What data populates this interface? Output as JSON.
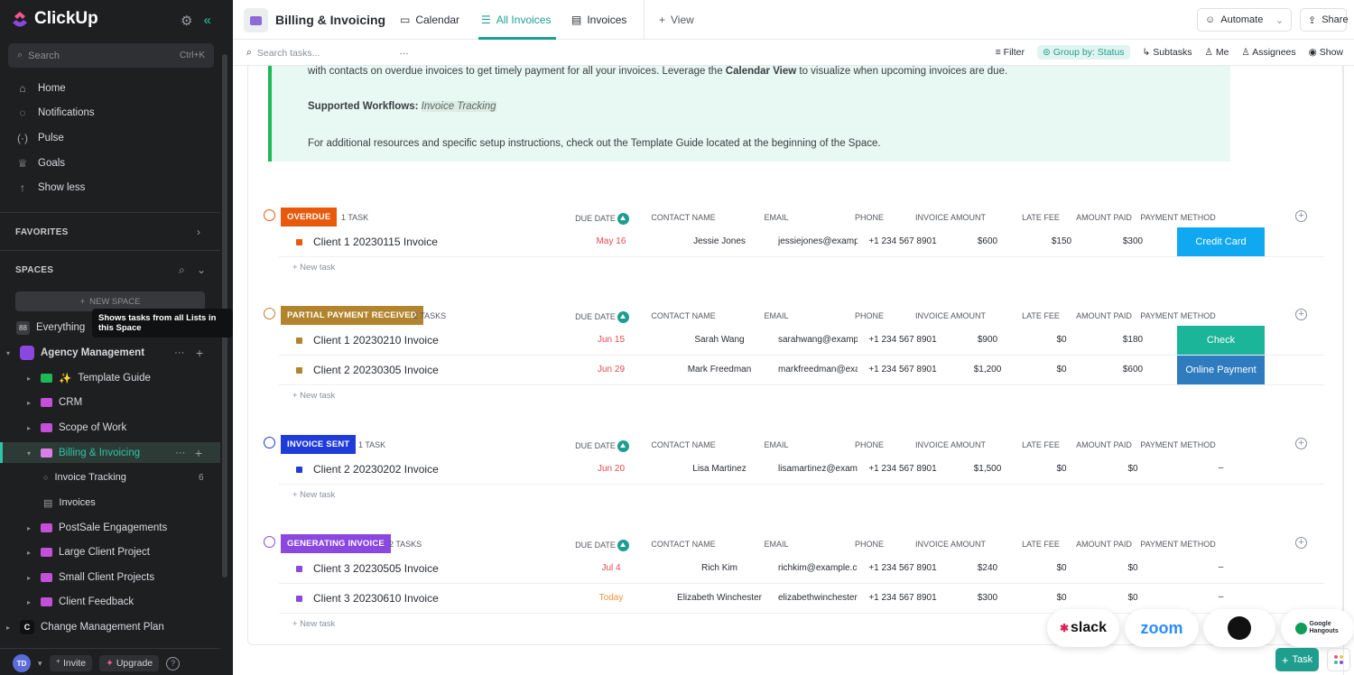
{
  "app": {
    "name": "ClickUp"
  },
  "sidebar": {
    "search": {
      "placeholder": "Search",
      "shortcut": "Ctrl+K"
    },
    "nav": [
      "Home",
      "Notifications",
      "Pulse",
      "Goals",
      "Show less"
    ],
    "favorites": "FAVORITES",
    "spaces": "SPACES",
    "new_space": "NEW SPACE",
    "tooltip": "Shows tasks from all Lists in this Space",
    "everything": "Everything",
    "space_name": "Agency Management",
    "folders": [
      "Template Guide",
      "CRM",
      "Scope of Work",
      "Billing & Invoicing"
    ],
    "lists": [
      "Invoice Tracking",
      "Invoices"
    ],
    "list_count": "6",
    "more_folders": [
      "PostSale Engagements",
      "Large Client Project",
      "Small Client Projects",
      "Client Feedback"
    ],
    "space2_letter": "C",
    "space2": "Change Management Plan",
    "avatar": "TD",
    "invite": "Invite",
    "upgrade": "Upgrade"
  },
  "topbar": {
    "title": "Billing & Invoicing",
    "tabs": [
      "Calendar",
      "All Invoices",
      "Invoices"
    ],
    "add_view": "View",
    "automate": "Automate",
    "share": "Share"
  },
  "toolbar": {
    "search_placeholder": "Search tasks...",
    "filter": "Filter",
    "group_by": "Group by: Status",
    "subtasks": "Subtasks",
    "me": "Me",
    "assignees": "Assignees",
    "show": "Show"
  },
  "callout": {
    "line1_pre": "with contacts on overdue invoices to get timely payment for all your invoices. Leverage the ",
    "line1_bold": "Calendar View",
    "line1_post": " to visualize when upcoming invoices are due.",
    "workflows_label": "Supported Workflows:",
    "workflows_value": "Invoice Tracking",
    "resources": "For additional resources and specific setup instructions, check out the Template Guide located at the beginning of the Space."
  },
  "columns": {
    "due": "DUE DATE",
    "contact": "CONTACT NAME",
    "email": "EMAIL",
    "phone": "PHONE",
    "amount": "INVOICE AMOUNT",
    "late": "LATE FEE",
    "paid": "AMOUNT PAID",
    "method": "PAYMENT METHOD"
  },
  "new_task": "+ New task",
  "groups": [
    {
      "status": "OVERDUE",
      "color": "#e8590c",
      "count": "1 TASK",
      "rows": [
        {
          "name": "Client 1 20230115 Invoice",
          "due": "May 16",
          "contact": "Jessie Jones",
          "email": "jessiejones@example.com",
          "phone": "+1 234 567 8901",
          "amount": "$600",
          "late": "$150",
          "paid": "$300",
          "method": "Credit Card",
          "method_color": "#10a8f0"
        }
      ]
    },
    {
      "status": "PARTIAL PAYMENT RECEIVED",
      "color": "#b2842d",
      "count": "2 TASKS",
      "rows": [
        {
          "name": "Client 1 20230210 Invoice",
          "due": "Jun 15",
          "contact": "Sarah Wang",
          "email": "sarahwang@example.com",
          "phone": "+1 234 567 8901",
          "amount": "$900",
          "late": "$0",
          "paid": "$180",
          "method": "Check",
          "method_color": "#1bb59a"
        },
        {
          "name": "Client 2 20230305 Invoice",
          "due": "Jun 29",
          "contact": "Mark Freedman",
          "email": "markfreedman@example.com",
          "phone": "+1 234 567 8901",
          "amount": "$1,200",
          "late": "$0",
          "paid": "$600",
          "method": "Online Payment",
          "method_color": "#2e7bbf"
        }
      ]
    },
    {
      "status": "INVOICE SENT",
      "color": "#1f3bd9",
      "count": "1 TASK",
      "rows": [
        {
          "name": "Client 2 20230202 Invoice",
          "due": "Jun 20",
          "contact": "Lisa Martinez",
          "email": "lisamartinez@example.com",
          "phone": "+1 234 567 8901",
          "amount": "$1,500",
          "late": "$0",
          "paid": "$0",
          "method": "–",
          "method_color": ""
        }
      ]
    },
    {
      "status": "GENERATING INVOICE",
      "color": "#8b47e0",
      "count": "2 TASKS",
      "rows": [
        {
          "name": "Client 3 20230505 Invoice",
          "due": "Jul 4",
          "contact": "Rich Kim",
          "email": "richkim@example.com",
          "phone": "+1 234 567 8901",
          "amount": "$240",
          "late": "$0",
          "paid": "$0",
          "method": "–",
          "method_color": ""
        },
        {
          "name": "Client 3 20230610 Invoice",
          "due": "Today",
          "contact": "Elizabeth Winchester",
          "email": "elizabethwinchester@example.com",
          "phone": "+1 234 567 8901",
          "amount": "$300",
          "late": "$0",
          "paid": "$0",
          "method": "–",
          "method_color": ""
        }
      ]
    }
  ],
  "integrations": [
    "slack",
    "zoom",
    "github",
    "Google Hangouts"
  ],
  "fab": "Task"
}
